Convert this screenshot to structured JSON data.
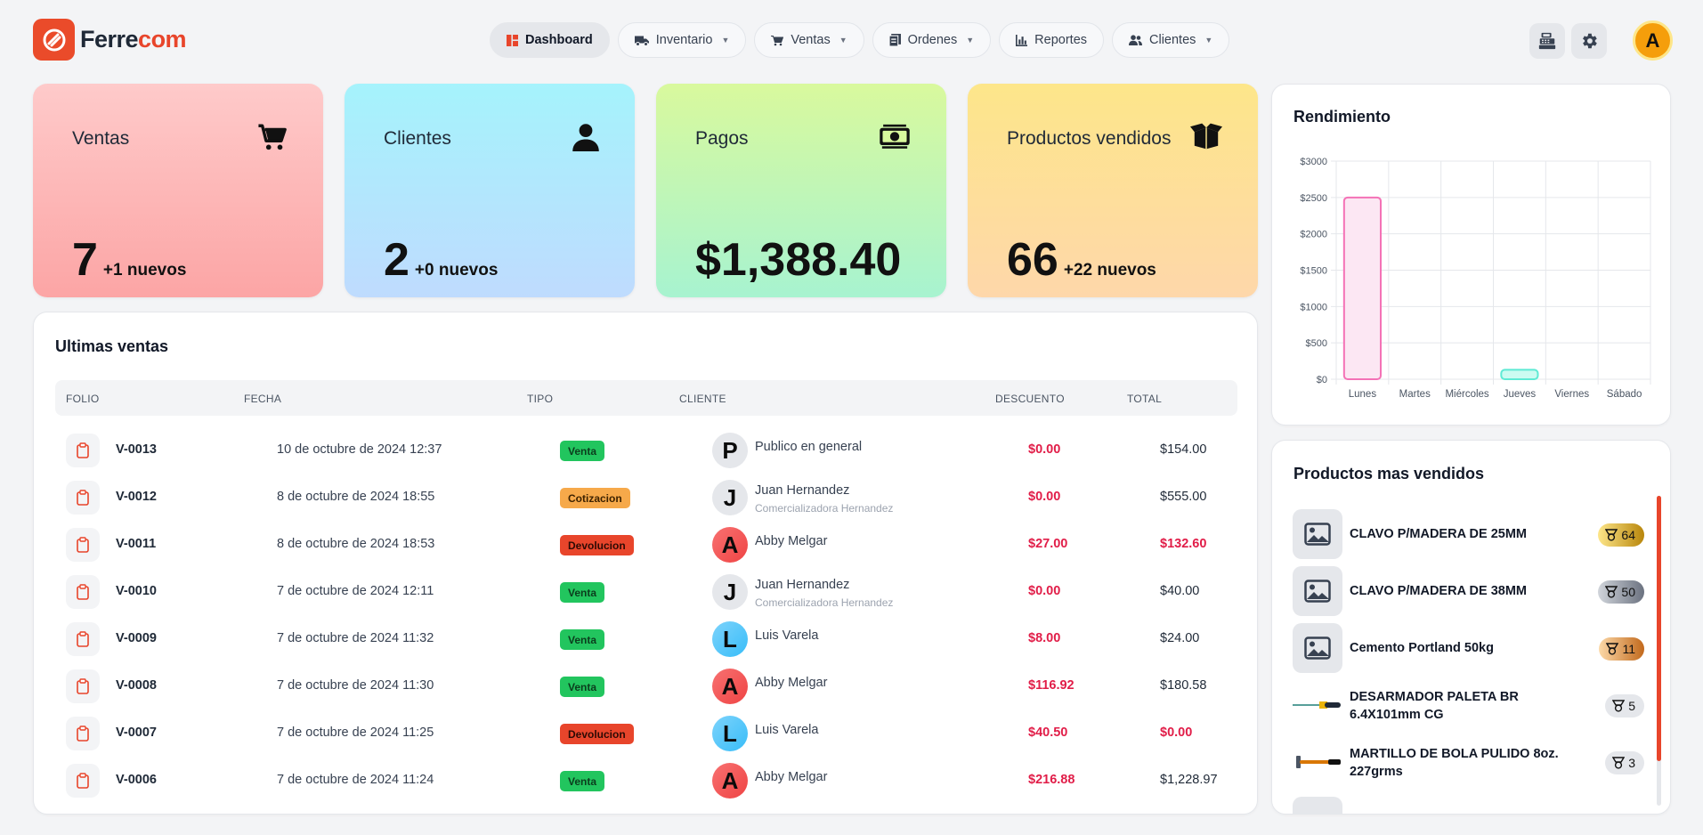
{
  "app": {
    "brand_part1": "Ferre",
    "brand_part2": "com",
    "user_initial": "A"
  },
  "nav": [
    {
      "label": "Dashboard",
      "icon": "dashboard-icon",
      "active": true,
      "dropdown": false
    },
    {
      "label": "Inventario",
      "icon": "truck-icon",
      "active": false,
      "dropdown": true
    },
    {
      "label": "Ventas",
      "icon": "cart-icon",
      "active": false,
      "dropdown": true
    },
    {
      "label": "Ordenes",
      "icon": "orders-icon",
      "active": false,
      "dropdown": true
    },
    {
      "label": "Reportes",
      "icon": "bar-chart-icon",
      "active": false,
      "dropdown": false
    },
    {
      "label": "Clientes",
      "icon": "users-icon",
      "active": false,
      "dropdown": true
    }
  ],
  "stats": {
    "ventas": {
      "label": "Ventas",
      "value": "7",
      "sub": "+1 nuevos"
    },
    "clientes": {
      "label": "Clientes",
      "value": "2",
      "sub": "+0 nuevos"
    },
    "pagos": {
      "label": "Pagos",
      "value": "$1,388.40"
    },
    "productos": {
      "label": "Productos vendidos",
      "value": "66",
      "sub": "+22 nuevos"
    }
  },
  "ventas": {
    "title": "Ultimas ventas",
    "columns": [
      "FOLIO",
      "FECHA",
      "TIPO",
      "CLIENTE",
      "DESCUENTO",
      "TOTAL"
    ],
    "rows": [
      {
        "folio": "V-0013",
        "fecha": "10 de octubre de 2024 12:37",
        "tipo": "Venta",
        "tipo_class": "venta",
        "initial": "P",
        "cliente": "Publico en general",
        "empresa": "",
        "descuento": "$0.00",
        "total": "$154.00",
        "neg": false
      },
      {
        "folio": "V-0012",
        "fecha": "8 de octubre de 2024 18:55",
        "tipo": "Cotizacion",
        "tipo_class": "cotizacion",
        "initial": "J",
        "cliente": "Juan Hernandez",
        "empresa": "Comercializadora Hernandez",
        "descuento": "$0.00",
        "total": "$555.00",
        "neg": false
      },
      {
        "folio": "V-0011",
        "fecha": "8 de octubre de 2024 18:53",
        "tipo": "Devolucion",
        "tipo_class": "devolucion",
        "initial": "A",
        "cliente": "Abby Melgar",
        "empresa": "",
        "descuento": "$27.00",
        "total": "$132.60",
        "neg": true
      },
      {
        "folio": "V-0010",
        "fecha": "7 de octubre de 2024 12:11",
        "tipo": "Venta",
        "tipo_class": "venta",
        "initial": "J",
        "cliente": "Juan Hernandez",
        "empresa": "Comercializadora Hernandez",
        "descuento": "$0.00",
        "total": "$40.00",
        "neg": false
      },
      {
        "folio": "V-0009",
        "fecha": "7 de octubre de 2024 11:32",
        "tipo": "Venta",
        "tipo_class": "venta",
        "initial": "L",
        "cliente": "Luis Varela",
        "empresa": "",
        "descuento": "$8.00",
        "total": "$24.00",
        "neg": false
      },
      {
        "folio": "V-0008",
        "fecha": "7 de octubre de 2024 11:30",
        "tipo": "Venta",
        "tipo_class": "venta",
        "initial": "A",
        "cliente": "Abby Melgar",
        "empresa": "",
        "descuento": "$116.92",
        "total": "$180.58",
        "neg": false
      },
      {
        "folio": "V-0007",
        "fecha": "7 de octubre de 2024 11:25",
        "tipo": "Devolucion",
        "tipo_class": "devolucion",
        "initial": "L",
        "cliente": "Luis Varela",
        "empresa": "",
        "descuento": "$40.50",
        "total": "$0.00",
        "neg": true
      },
      {
        "folio": "V-0006",
        "fecha": "7 de octubre de 2024 11:24",
        "tipo": "Venta",
        "tipo_class": "venta",
        "initial": "A",
        "cliente": "Abby Melgar",
        "empresa": "",
        "descuento": "$216.88",
        "total": "$1,228.97",
        "neg": false
      }
    ]
  },
  "rendimiento": {
    "title": "Rendimiento"
  },
  "chart_data": {
    "type": "bar",
    "title": "Rendimiento",
    "categories": [
      "Lunes",
      "Martes",
      "Miércoles",
      "Jueves",
      "Viernes",
      "Sábado"
    ],
    "values": [
      2500,
      0,
      0,
      130,
      0,
      0
    ],
    "ylim": [
      0,
      3000
    ],
    "yticks": [
      "$0",
      "$500",
      "$1000",
      "$1500",
      "$2000",
      "$2500",
      "$3000"
    ],
    "grid": true,
    "colors": [
      "#f472b6",
      "#5eead4"
    ]
  },
  "top_productos": {
    "title": "Productos mas vendidos",
    "items": [
      {
        "name": "CLAVO P/MADERA DE 25MM",
        "count": "64",
        "medal": "gold",
        "thumb": "image-placeholder-icon"
      },
      {
        "name": "CLAVO P/MADERA DE 38MM",
        "count": "50",
        "medal": "silver",
        "thumb": "image-placeholder-icon"
      },
      {
        "name": "Cemento Portland 50kg",
        "count": "11",
        "medal": "bronze",
        "thumb": "image-placeholder-icon"
      },
      {
        "name": "DESARMADOR PALETA BR 6.4X101mm CG",
        "count": "5",
        "medal": "plain",
        "thumb": "screwdriver-icon"
      },
      {
        "name": "MARTILLO DE BOLA PULIDO 8oz. 227grms",
        "count": "3",
        "medal": "plain",
        "thumb": "hammer-icon"
      }
    ]
  }
}
